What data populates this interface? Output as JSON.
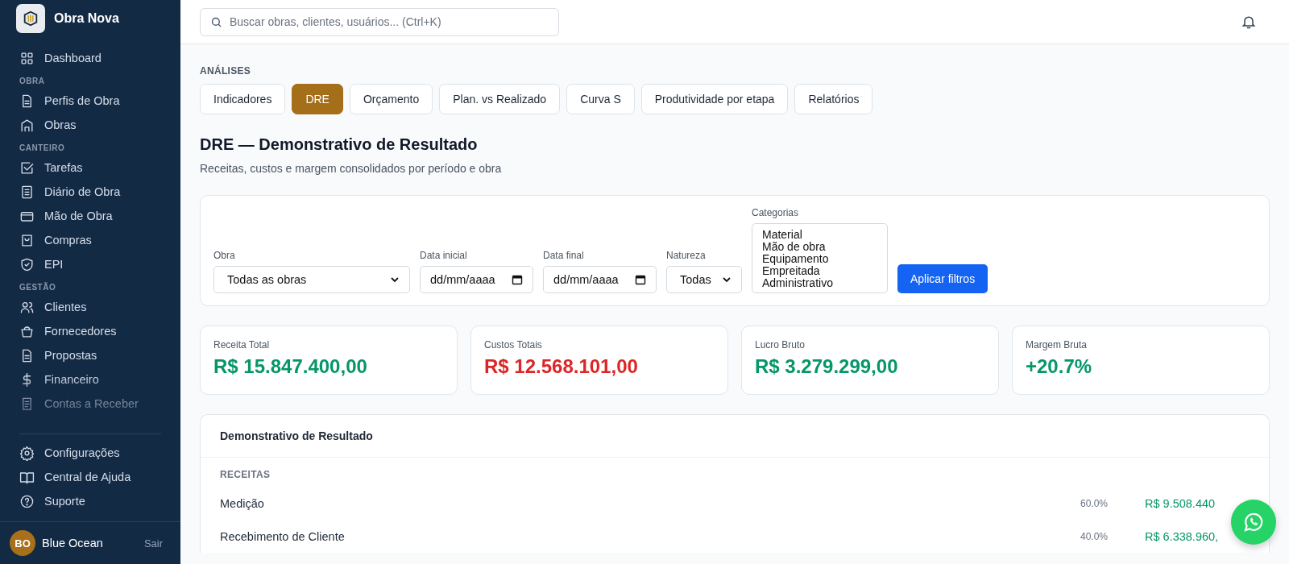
{
  "app": {
    "name": "Obra Nova"
  },
  "sidebar": {
    "sections": [
      {
        "items": [
          {
            "label": "Dashboard"
          }
        ]
      },
      {
        "heading": "OBRA",
        "items": [
          {
            "label": "Perfis de Obra"
          },
          {
            "label": "Obras"
          }
        ]
      },
      {
        "heading": "CANTEIRO",
        "items": [
          {
            "label": "Tarefas"
          },
          {
            "label": "Diário de Obra"
          },
          {
            "label": "Mão de Obra"
          },
          {
            "label": "Compras"
          },
          {
            "label": "EPI"
          }
        ]
      },
      {
        "heading": "GESTÃO",
        "items": [
          {
            "label": "Clientes"
          },
          {
            "label": "Fornecedores"
          },
          {
            "label": "Propostas"
          },
          {
            "label": "Financeiro"
          },
          {
            "label": "Contas a Receber"
          }
        ]
      }
    ],
    "bottom_items": [
      {
        "label": "Configurações"
      },
      {
        "label": "Central de Ajuda"
      },
      {
        "label": "Suporte"
      }
    ],
    "user": {
      "initials": "BO",
      "name": "Blue Ocean",
      "logout": "Sair"
    }
  },
  "search": {
    "placeholder": "Buscar obras, clientes, usuários... (Ctrl+K)"
  },
  "section_label": "ANÁLISES",
  "tabs": [
    {
      "label": "Indicadores",
      "selected": false
    },
    {
      "label": "DRE",
      "selected": true
    },
    {
      "label": "Orçamento",
      "selected": false
    },
    {
      "label": "Plan. vs Realizado",
      "selected": false
    },
    {
      "label": "Curva S",
      "selected": false
    },
    {
      "label": "Produtividade por etapa",
      "selected": false
    },
    {
      "label": "Relatórios",
      "selected": false
    }
  ],
  "page": {
    "title": "DRE — Demonstrativo de Resultado",
    "subtitle": "Receitas, custos e margem consolidados por período e obra"
  },
  "filters": {
    "obra": {
      "label": "Obra",
      "value": "Todas as obras"
    },
    "data_inicial": {
      "label": "Data inicial",
      "value": "dd/mm/aaaa"
    },
    "data_final": {
      "label": "Data final",
      "value": "dd/mm/aaaa"
    },
    "natureza": {
      "label": "Natureza",
      "value": "Todas"
    },
    "categorias": {
      "label": "Categorias",
      "options": [
        "Material",
        "Mão de obra",
        "Equipamento",
        "Empreitada",
        "Administrativo"
      ]
    },
    "apply": "Aplicar filtros"
  },
  "kpis": [
    {
      "label": "Receita Total",
      "value": "R$ 15.847.400,00",
      "color": "#059669"
    },
    {
      "label": "Custos Totais",
      "value": "R$ 12.568.101,00",
      "color": "#dc2626"
    },
    {
      "label": "Lucro Bruto",
      "value": "R$ 3.279.299,00",
      "color": "#059669"
    },
    {
      "label": "Margem Bruta",
      "value": "+20.7%",
      "color": "#059669"
    }
  ],
  "statement": {
    "title": "Demonstrativo de Resultado",
    "groups": [
      {
        "heading": "RECEITAS",
        "rows": [
          {
            "label": "Medição",
            "share": "60.0%",
            "value": "R$ 9.508.440"
          },
          {
            "label": "Recebimento de Cliente",
            "share": "40.0%",
            "value": "R$ 6.338.960,"
          }
        ]
      }
    ]
  }
}
